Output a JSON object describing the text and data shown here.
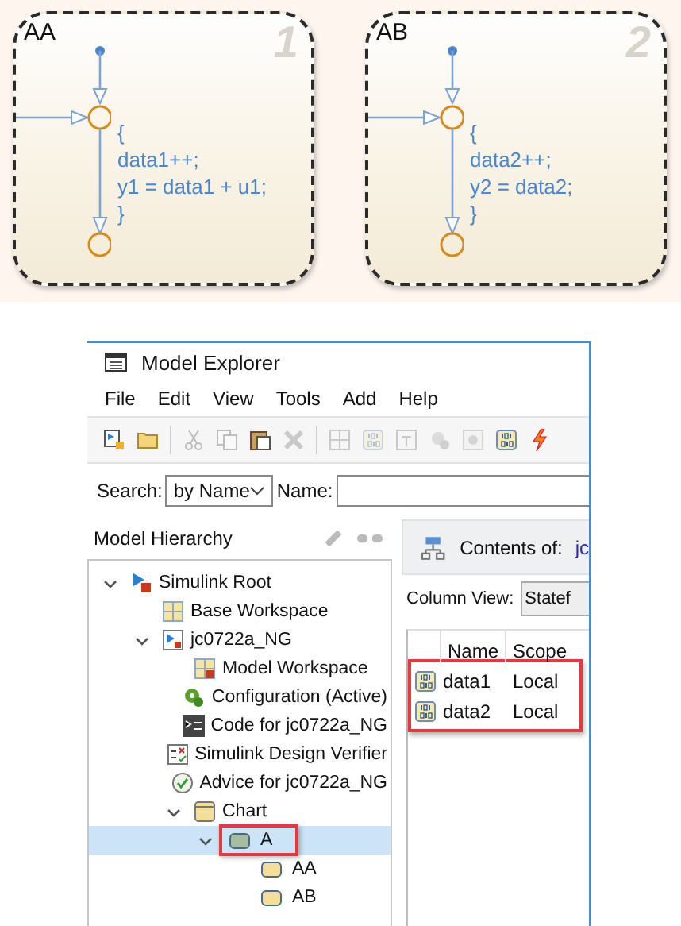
{
  "states": [
    {
      "name": "AA",
      "number": "1",
      "code": [
        "{",
        "data1++;",
        "y1 = data1 + u1;",
        "}"
      ]
    },
    {
      "name": "AB",
      "number": "2",
      "code": [
        "{",
        "data2++;",
        "y2 = data2;",
        "}"
      ]
    }
  ],
  "model_explorer": {
    "title": "Model Explorer",
    "menu": [
      "File",
      "Edit",
      "View",
      "Tools",
      "Add",
      "Help"
    ],
    "toolbar": [
      {
        "kind": "new-model",
        "disabled": false
      },
      {
        "kind": "open",
        "disabled": false
      },
      {
        "kind": "separator"
      },
      {
        "kind": "cut",
        "disabled": true
      },
      {
        "kind": "copy",
        "disabled": true
      },
      {
        "kind": "paste",
        "disabled": false
      },
      {
        "kind": "delete",
        "disabled": true
      },
      {
        "kind": "separator"
      },
      {
        "kind": "grid",
        "disabled": true
      },
      {
        "kind": "data",
        "disabled": true
      },
      {
        "kind": "event",
        "disabled": true
      },
      {
        "kind": "config",
        "disabled": true
      },
      {
        "kind": "gear",
        "disabled": true
      },
      {
        "kind": "data",
        "disabled": false
      },
      {
        "kind": "lightning",
        "disabled": false
      }
    ],
    "search": {
      "label": "Search:",
      "value": "by Name"
    },
    "name_field": {
      "label": "Name:"
    },
    "hierarchy": {
      "title": "Model Hierarchy",
      "tree": [
        {
          "label": "Simulink Root",
          "kind": "root",
          "expanded": true,
          "selected": false,
          "highlighted": false,
          "children": [
            {
              "label": "Base Workspace",
              "kind": "workspace",
              "selected": false,
              "highlighted": false
            },
            {
              "label": "jc0722a_NG",
              "kind": "model",
              "expanded": true,
              "selected": false,
              "highlighted": false,
              "children": [
                {
                  "label": "Model Workspace",
                  "kind": "model-workspace",
                  "selected": false,
                  "highlighted": false
                },
                {
                  "label": "Configuration (Active)",
                  "kind": "config",
                  "selected": false,
                  "highlighted": false
                },
                {
                  "label": "Code for jc0722a_NG",
                  "kind": "code",
                  "selected": false,
                  "highlighted": false
                },
                {
                  "label": "Simulink Design Verifier",
                  "kind": "verifier",
                  "selected": false,
                  "highlighted": false
                },
                {
                  "label": "Advice for jc0722a_NG",
                  "kind": "advice",
                  "selected": false,
                  "highlighted": false
                },
                {
                  "label": "Chart",
                  "kind": "chart",
                  "expanded": true,
                  "selected": false,
                  "highlighted": false,
                  "children": [
                    {
                      "label": "A",
                      "kind": "state-selected",
                      "expanded": true,
                      "selected": true,
                      "highlighted": true,
                      "children": [
                        {
                          "label": "AA",
                          "kind": "state",
                          "selected": false,
                          "highlighted": false
                        },
                        {
                          "label": "AB",
                          "kind": "state",
                          "selected": false,
                          "highlighted": false
                        }
                      ]
                    }
                  ]
                }
              ]
            }
          ]
        }
      ]
    },
    "contents": {
      "label": "Contents of:",
      "path": "jc",
      "column_view": {
        "label": "Column View:",
        "value": "Statef"
      },
      "columns": [
        "Name",
        "Scope"
      ],
      "highlighted": true,
      "rows": [
        {
          "name": "data1",
          "scope": "Local"
        },
        {
          "name": "data2",
          "scope": "Local"
        }
      ]
    }
  }
}
